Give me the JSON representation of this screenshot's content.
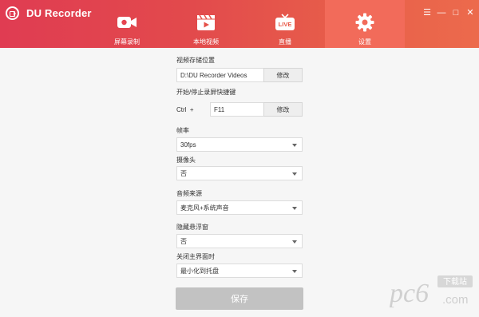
{
  "app": {
    "title": "DU Recorder"
  },
  "colors": {
    "header_start": "#e03c52",
    "header_end": "#ec6a4c",
    "active_tab": "#f26b5a",
    "save_disabled": "#c2c2c2"
  },
  "nav": [
    {
      "label": "屏幕录制",
      "icon": "video-camera-icon"
    },
    {
      "label": "本地视频",
      "icon": "film-icon"
    },
    {
      "label": "直播",
      "icon": "live-tv-icon",
      "badge": "LIVE"
    },
    {
      "label": "设置",
      "icon": "gear-icon",
      "active": true
    }
  ],
  "window_controls": {
    "menu": "☰",
    "minimize": "—",
    "maximize": "□",
    "close": "✕"
  },
  "settings": {
    "save_location": {
      "label": "视频存储位置",
      "value": "D:\\DU Recorder Videos",
      "button": "修改"
    },
    "shortcut": {
      "label": "开始/停止录屏快捷键",
      "modifier": "Ctrl",
      "plus": "+",
      "key": "F11",
      "button": "修改"
    },
    "framerate": {
      "label": "帧率",
      "value": "30fps"
    },
    "camera": {
      "label": "摄像头",
      "value": "否"
    },
    "audio": {
      "label": "音频来源",
      "value": "麦克风+系统声音"
    },
    "hide_float": {
      "label": "隐藏悬浮窗",
      "value": "否"
    },
    "close_main": {
      "label": "关闭主界面时",
      "value": "最小化到托盘"
    },
    "save_button": "保存"
  },
  "watermark": {
    "text": "pc6",
    "sub": ".com",
    "tag": "下载站"
  }
}
